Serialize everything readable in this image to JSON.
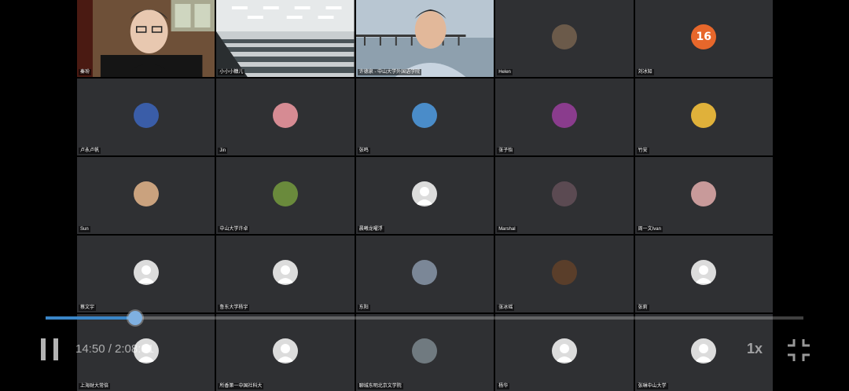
{
  "participants": [
    {
      "name": "秦玢",
      "type": "video",
      "scene": "man-room"
    },
    {
      "name": "小小小糠儿",
      "type": "video",
      "scene": "lecture-hall"
    },
    {
      "name": "许德泉 - 中山大学外国语学院",
      "type": "video",
      "scene": "man-pier",
      "speaking": true
    },
    {
      "name": "Helen",
      "type": "avatar",
      "color": "#6b5a4a"
    },
    {
      "name": "刘冰知",
      "type": "avatar",
      "color": "#e7672b",
      "badge": "16"
    },
    {
      "name": "卢永卢帆",
      "type": "avatar",
      "color": "#3a5da8"
    },
    {
      "name": "Jin",
      "type": "avatar",
      "color": "#d68b93"
    },
    {
      "name": "张鸣",
      "type": "avatar",
      "color": "#4a8cc9"
    },
    {
      "name": "张子怡",
      "type": "avatar",
      "color": "#8a3c8d"
    },
    {
      "name": "竹安",
      "type": "avatar",
      "color": "#e0b13a"
    },
    {
      "name": "Sun",
      "type": "avatar",
      "color": "#caa27e"
    },
    {
      "name": "中山大学许卓",
      "type": "avatar",
      "color": "#6a8a3c"
    },
    {
      "name": "晨曦龙曜浮",
      "type": "avatar-default"
    },
    {
      "name": "Marshal",
      "type": "avatar",
      "color": "#5b4a52"
    },
    {
      "name": "周一文Ivan",
      "type": "avatar",
      "color": "#c89a9a"
    },
    {
      "name": "蔡文宇",
      "type": "avatar-default"
    },
    {
      "name": "鲁东大学杨宇",
      "type": "avatar-default"
    },
    {
      "name": "东阳",
      "type": "avatar",
      "color": "#7b8797"
    },
    {
      "name": "张冰瑶",
      "type": "avatar",
      "color": "#5a3e2a"
    },
    {
      "name": "张莉",
      "type": "avatar-default"
    },
    {
      "name": "上海财大常倍",
      "type": "avatar-default"
    },
    {
      "name": "所香第一中国社科大",
      "type": "avatar-default"
    },
    {
      "name": "聊城东明北京文学院",
      "type": "avatar",
      "color": "#707a80"
    },
    {
      "name": "杨华",
      "type": "avatar-default"
    },
    {
      "name": "张琳中山大学",
      "type": "avatar-default"
    }
  ],
  "player": {
    "time": "14:50 / 2:08:31",
    "speed": "1x",
    "progress_fraction": 0.118
  }
}
